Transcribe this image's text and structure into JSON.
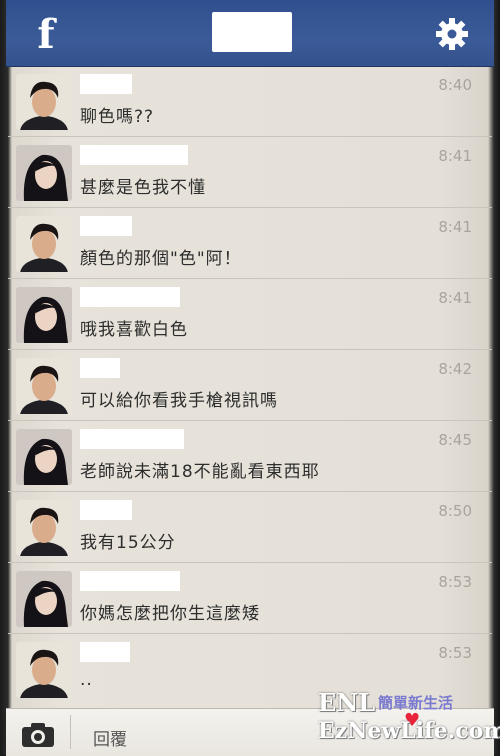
{
  "header": {
    "logo": "f",
    "title": "",
    "settings_icon": "gear-icon"
  },
  "messages": [
    {
      "sender": "male",
      "time": "8:40",
      "text": "聊色嗎??"
    },
    {
      "sender": "female",
      "time": "8:41",
      "text": "甚麼是色我不懂"
    },
    {
      "sender": "male",
      "time": "8:41",
      "text": "顏色的那個\"色\"阿！"
    },
    {
      "sender": "female",
      "time": "8:41",
      "text": "哦我喜歡白色"
    },
    {
      "sender": "male",
      "time": "8:42",
      "text": "可以給你看我手槍視訊嗎"
    },
    {
      "sender": "female",
      "time": "8:45",
      "text": "老師說未滿18不能亂看東西耶"
    },
    {
      "sender": "male",
      "time": "8:50",
      "text": "我有15公分"
    },
    {
      "sender": "female",
      "time": "8:53",
      "text": "你媽怎麼把你生這麼矮"
    },
    {
      "sender": "male",
      "time": "8:53",
      "text": ".."
    }
  ],
  "footer": {
    "camera_icon": "camera-icon",
    "reply_placeholder": "回覆"
  },
  "watermark": {
    "brand": "ENL",
    "tagline": "簡單新生活",
    "url": "EzNewLife.com"
  },
  "colors": {
    "header": "#3b5b98",
    "list_bg": "#e6e2d9",
    "time": "#a9a59c"
  }
}
